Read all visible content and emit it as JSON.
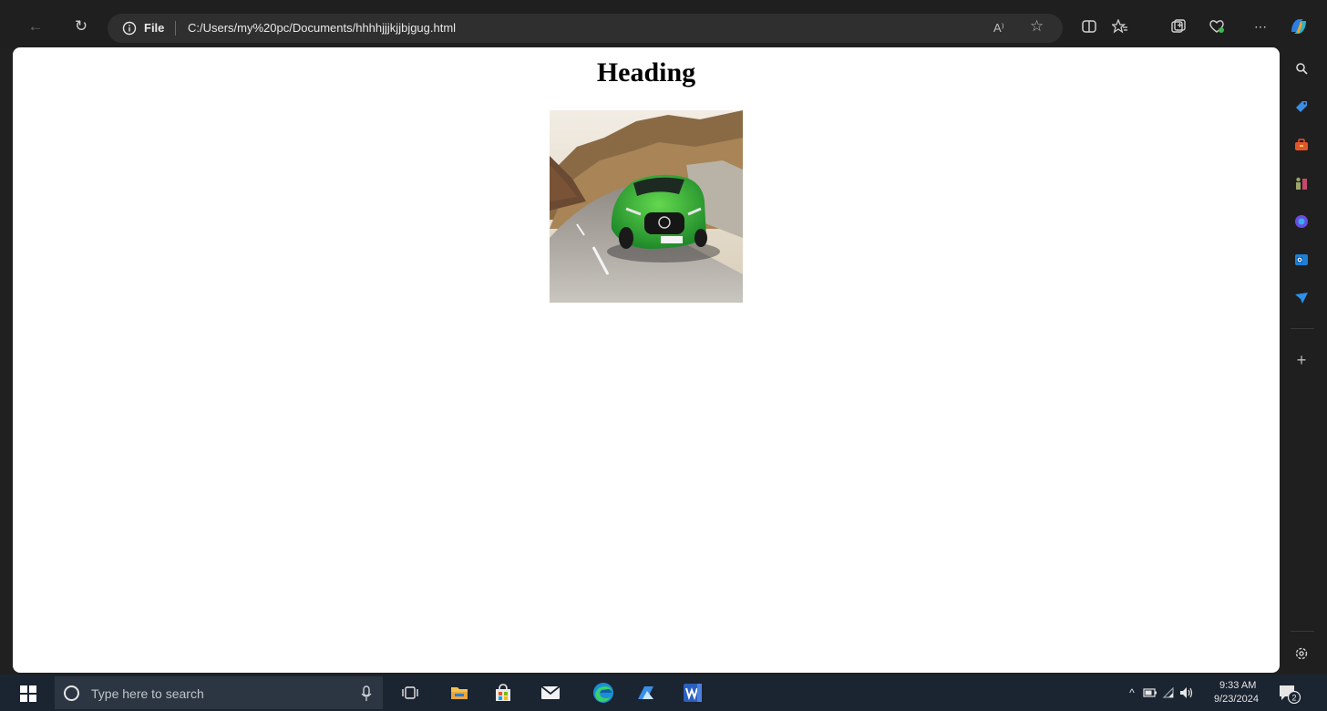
{
  "browser": {
    "address_bar": {
      "file_label": "File",
      "url": "C:/Users/my%20pc/Documents/hhhhjjjkjjbjgug.html",
      "read_aloud_label": "A⁾"
    }
  },
  "page": {
    "heading": "Heading",
    "image": {
      "description": "green sports car on mountain road"
    }
  },
  "taskbar": {
    "search_placeholder": "Type here to search",
    "time": "9:33 AM",
    "date": "9/23/2024",
    "notification_count": "2"
  },
  "colors": {
    "toolbar_bg": "#1f1f1f",
    "address_bg": "#2f2f2f",
    "page_bg": "#ffffff",
    "taskbar_bg": "#1b2431",
    "edge_blue": "#1a8fd6",
    "word_blue": "#2b5fbf"
  }
}
